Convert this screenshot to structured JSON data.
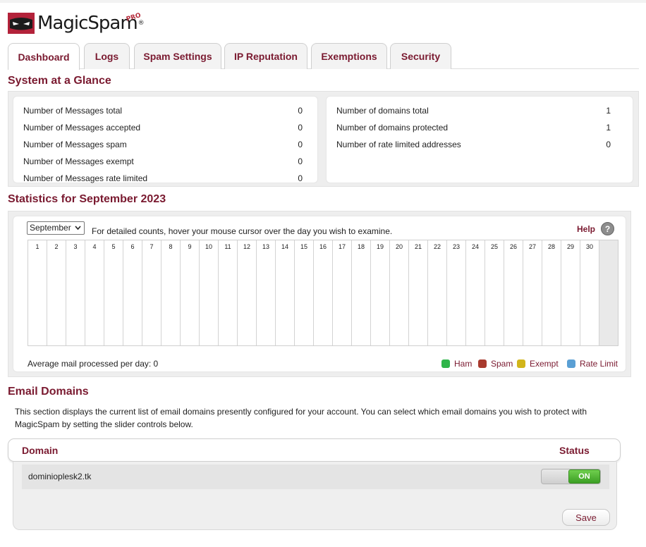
{
  "brand": {
    "name": "MagicSpam",
    "badge": "PRO",
    "reg": "®"
  },
  "tabs": [
    {
      "label": "Dashboard",
      "active": true
    },
    {
      "label": "Logs"
    },
    {
      "label": "Spam Settings"
    },
    {
      "label": "IP Reputation"
    },
    {
      "label": "Exemptions"
    },
    {
      "label": "Security"
    }
  ],
  "glance": {
    "title": "System at a Glance",
    "messages": [
      {
        "label": "Number of Messages total",
        "value": "0"
      },
      {
        "label": "Number of Messages accepted",
        "value": "0"
      },
      {
        "label": "Number of Messages spam",
        "value": "0"
      },
      {
        "label": "Number of Messages exempt",
        "value": "0"
      },
      {
        "label": "Number of Messages rate limited",
        "value": "0"
      }
    ],
    "domains": [
      {
        "label": "Number of domains total",
        "value": "1"
      },
      {
        "label": "Number of domains protected",
        "value": "1"
      },
      {
        "label": "Number of rate limited addresses",
        "value": "0"
      }
    ]
  },
  "stats": {
    "title": "Statistics for September 2023",
    "month": "September",
    "hint": "For detailed counts, hover your mouse cursor over the day you wish to examine.",
    "help": "Help",
    "help_icon": "?",
    "days": [
      "1",
      "2",
      "3",
      "4",
      "5",
      "6",
      "7",
      "8",
      "9",
      "10",
      "11",
      "12",
      "13",
      "14",
      "15",
      "16",
      "17",
      "18",
      "19",
      "20",
      "21",
      "22",
      "23",
      "24",
      "25",
      "26",
      "27",
      "28",
      "29",
      "30"
    ],
    "average": "Average mail processed per day: 0",
    "legend": [
      {
        "label": "Ham",
        "color": "#2fb54a"
      },
      {
        "label": "Spam",
        "color": "#a83a2e"
      },
      {
        "label": "Exempt",
        "color": "#d2b51a"
      },
      {
        "label": "Rate Limit",
        "color": "#5a9fd4"
      }
    ]
  },
  "email_domains": {
    "title": "Email Domains",
    "description": "This section displays the current list of email domains presently configured for your account. You can select which email domains you wish to protect with MagicSpam by setting the slider controls below.",
    "col_domain": "Domain",
    "col_status": "Status",
    "rows": [
      {
        "domain": "dominioplesk2.tk",
        "status": "ON"
      }
    ],
    "save_label": "Save"
  },
  "colors": {
    "accent": "#7a1a30"
  }
}
